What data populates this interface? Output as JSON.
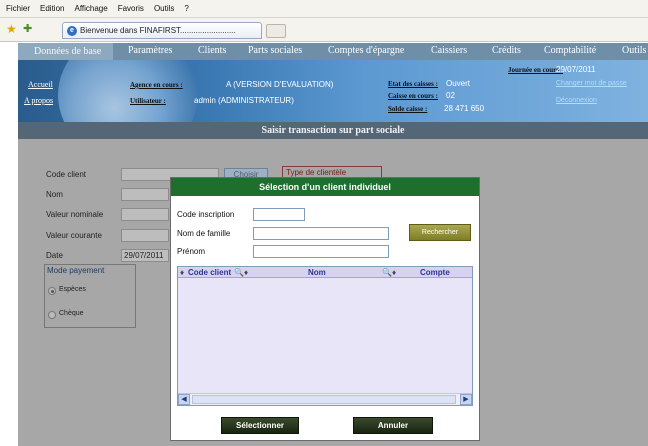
{
  "browser": {
    "menu": [
      "Fichier",
      "Edition",
      "Affichage",
      "Favoris",
      "Outils",
      "?"
    ],
    "tab_title": "Bienvenue dans FINAFIRST.........................",
    "tab_icon": "ie-icon"
  },
  "nav": {
    "items": [
      "Données de base",
      "Paramètres",
      "Clients",
      "Parts sociales",
      "Comptes d'épargne",
      "Caissiers",
      "Crédits",
      "Comptabilité",
      "Outils"
    ]
  },
  "banner": {
    "left_links": [
      "Accueil",
      "A propos"
    ],
    "agence_label": "Agence en cours :",
    "agence_value": "A (VERSION D'EVALUATION)",
    "user_label": "Utilisateur :",
    "user_value": "admin (ADMINISTRATEUR)",
    "etat_label": "Etat des caisses :",
    "etat_value": "Ouvert",
    "caisse_label": "Caisse en cours :",
    "caisse_value": "02",
    "solde_label": "Solde caisse :",
    "solde_value": "28 471 650",
    "journee_label": "Journée en cours :",
    "journee_value": "29/07/2011",
    "change_pwd": "Changer mot de passe",
    "logout": "Déconnexion"
  },
  "page_title": "Saisir transaction sur part sociale",
  "form": {
    "code_client_label": "Code client",
    "nom_label": "Nom",
    "valeur_nominale_label": "Valeur nominale",
    "valeur_courante_label": "Valeur courante",
    "date_label": "Date",
    "date_value": "29/07/2011",
    "choose_button": "Choisir",
    "type_clientele_label": "Type de clientèle",
    "mode_paiement_label": "Mode payement",
    "especes_label": "Espèces",
    "cheque_label": "Chèque"
  },
  "modal": {
    "title": "Sélection d'un client individuel",
    "code_inscription_label": "Code inscription",
    "nom_famille_label": "Nom de famille",
    "prenom_label": "Prénom",
    "search_button": "Rechercher",
    "columns": [
      "Code client",
      "Nom",
      "Compte"
    ],
    "select_button": "Sélectionner",
    "cancel_button": "Annuler"
  },
  "colors": {
    "modal_header": "#1e6e2c",
    "nav_bg": "#6f8ea8",
    "grid_header": "#d6d2f0"
  }
}
